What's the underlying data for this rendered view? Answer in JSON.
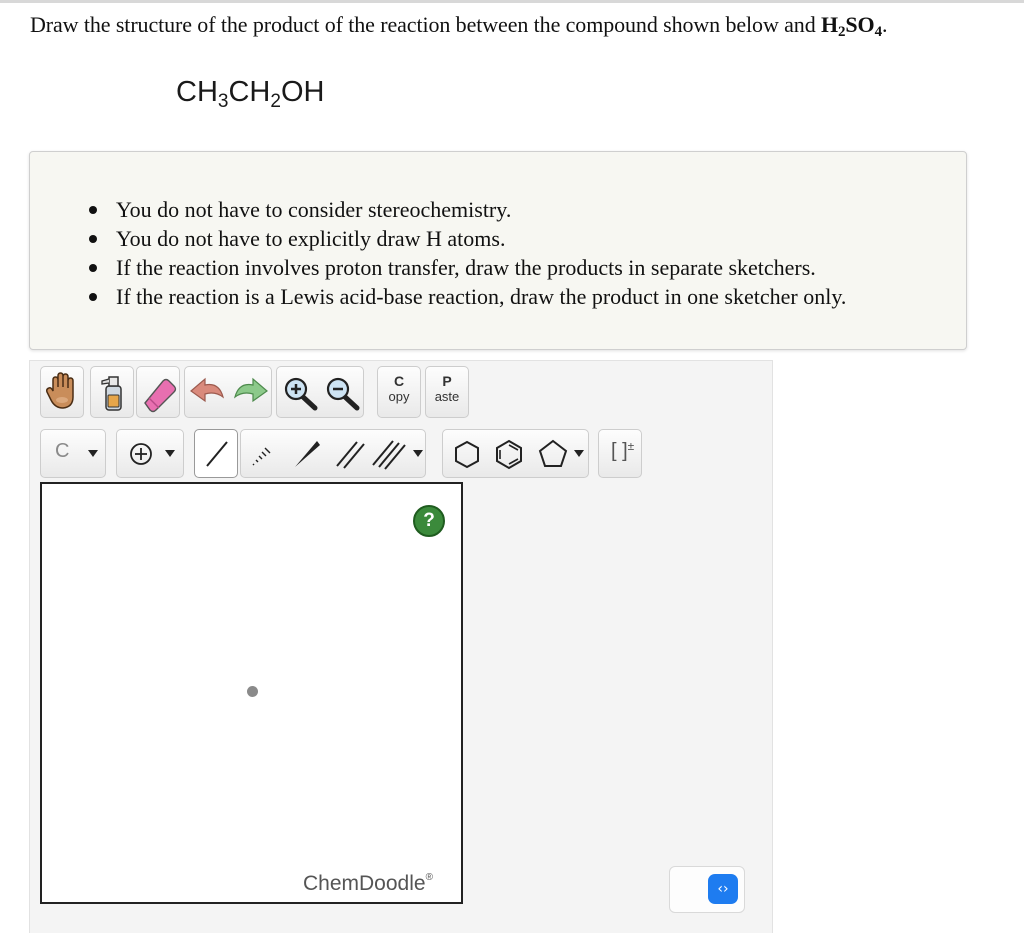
{
  "question": {
    "text_before": "Draw the structure of the product of the reaction between the compound shown below and ",
    "reagent": {
      "h": "H",
      "h_sub": "2",
      "so": "SO",
      "o_sub": "4",
      "period": "."
    }
  },
  "compound": {
    "p1": "CH",
    "s1": "3",
    "p2": "CH",
    "s2": "2",
    "p3": "OH"
  },
  "instructions": [
    "You do not have to consider stereochemistry.",
    "You do not have to explicitly draw H atoms.",
    "If the reaction involves proton transfer, draw the products in separate sketchers.",
    "If the reaction is a Lewis acid-base reaction, draw the product in one sketcher only."
  ],
  "toolbar": {
    "copy": {
      "big": "C",
      "small": "opy"
    },
    "paste": {
      "big": "P",
      "small": "aste"
    },
    "element": "C",
    "charge_bracket": {
      "text": "[ ]",
      "sup": "±"
    }
  },
  "canvas": {
    "help_label": "?",
    "brand": "ChemDoodle",
    "brand_mark": "®"
  },
  "resize_handle": {
    "glyph": "‹›"
  },
  "colors": {
    "help_green": "#3b8a3b",
    "resize_blue": "#1e7cf0",
    "eraser_pink": "#e86fb0",
    "undo_red": "#d98a7c",
    "redo_green": "#8cc98a"
  }
}
